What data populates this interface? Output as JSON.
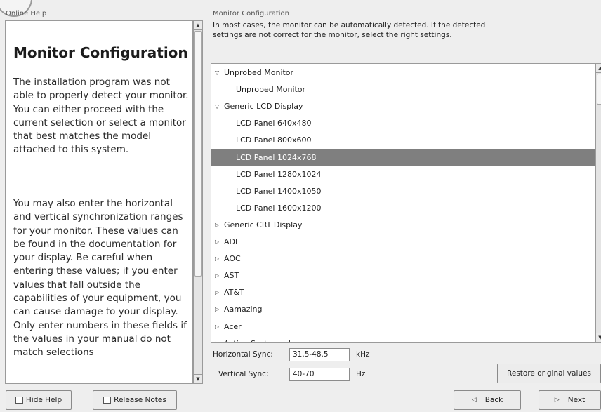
{
  "left_header": "Online Help",
  "right_header": "Monitor Configuration",
  "help": {
    "title": "Monitor Configuration",
    "paragraph1": "The installation program was not able to properly detect your monitor. You can either proceed with the current selection or select a monitor that best matches the model attached to this system.",
    "paragraph2": "You may also enter the horizontal and vertical synchronization ranges for your monitor. These values can be found in the documentation for your display. Be careful when entering these values; if you enter values that fall outside the capabilities of your equipment, you can cause damage to your display. Only enter numbers in these fields if the values in your manual do not match selections"
  },
  "intro": "In most cases, the monitor can be automatically detected. If the detected settings are not correct for the monitor, select the right settings.",
  "monitor_list": [
    {
      "label": "Unprobed Monitor",
      "level": 0,
      "expander": "▽",
      "selected": false
    },
    {
      "label": "Unprobed Monitor",
      "level": 1,
      "expander": "",
      "selected": false
    },
    {
      "label": "Generic LCD Display",
      "level": 0,
      "expander": "▽",
      "selected": false
    },
    {
      "label": "LCD Panel 640x480",
      "level": 1,
      "expander": "",
      "selected": false
    },
    {
      "label": "LCD Panel 800x600",
      "level": 1,
      "expander": "",
      "selected": false
    },
    {
      "label": "LCD Panel 1024x768",
      "level": 1,
      "expander": "",
      "selected": true
    },
    {
      "label": "LCD Panel 1280x1024",
      "level": 1,
      "expander": "",
      "selected": false
    },
    {
      "label": "LCD Panel 1400x1050",
      "level": 1,
      "expander": "",
      "selected": false
    },
    {
      "label": "LCD Panel 1600x1200",
      "level": 1,
      "expander": "",
      "selected": false
    },
    {
      "label": "Generic CRT Display",
      "level": 0,
      "expander": "▷",
      "selected": false
    },
    {
      "label": "ADI",
      "level": 0,
      "expander": "▷",
      "selected": false
    },
    {
      "label": "AOC",
      "level": 0,
      "expander": "▷",
      "selected": false
    },
    {
      "label": "AST",
      "level": 0,
      "expander": "▷",
      "selected": false
    },
    {
      "label": "AT&T",
      "level": 0,
      "expander": "▷",
      "selected": false
    },
    {
      "label": "Aamazing",
      "level": 0,
      "expander": "▷",
      "selected": false
    },
    {
      "label": "Acer",
      "level": 0,
      "expander": "▷",
      "selected": false
    },
    {
      "label": "Action Systems, Inc.",
      "level": 0,
      "expander": "▷",
      "selected": false
    }
  ],
  "sync": {
    "horizontal_label": "Horizontal Sync:",
    "horizontal_value": "31.5-48.5",
    "horizontal_unit": "kHz",
    "vertical_label": "Vertical Sync:",
    "vertical_value": "40-70",
    "vertical_unit": "Hz"
  },
  "buttons": {
    "restore": "Restore original values",
    "hide_help": "Hide Help",
    "release_notes": "Release Notes",
    "back": "Back",
    "next": "Next"
  },
  "icons": {
    "hide_help": "help-box-icon",
    "release_notes": "notes-icon",
    "back": "back-arrow-icon",
    "next": "next-arrow-icon"
  },
  "colors": {
    "selection": "#7f7f7f",
    "background": "#eeeeee"
  }
}
